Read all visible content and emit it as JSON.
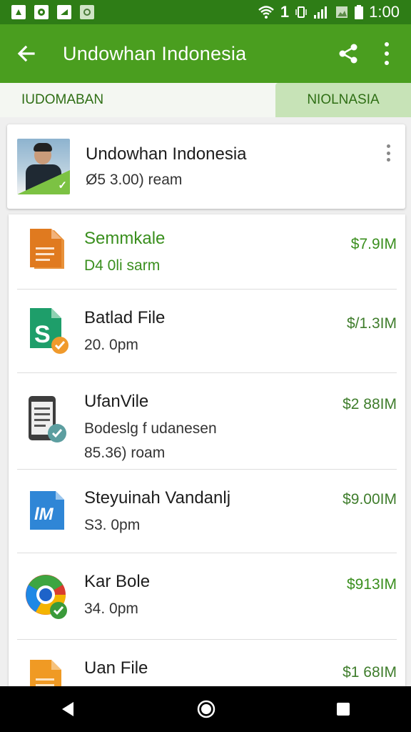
{
  "status_bar": {
    "time": "1:00",
    "notification_count": "1",
    "icons": [
      "app-icon",
      "record-icon",
      "cast-icon",
      "image-icon"
    ]
  },
  "app_bar": {
    "title": "Undowhan Indonesia",
    "icons": [
      "back-arrow-icon",
      "share-icon",
      "more-vert-icon"
    ]
  },
  "tabs": [
    {
      "label": "IUDOMABAN",
      "selected": false
    },
    {
      "label": "NIOLNASIA",
      "selected": true
    }
  ],
  "header_card": {
    "name": "Undowhan Indonesia",
    "subtitle": "Ø5 3.00) ream"
  },
  "files": [
    {
      "name": "Semmkale",
      "line1": "D4 0li sarm",
      "line2": "",
      "amount": "$7.9IM",
      "icon": "document-orange-icon",
      "name_green": true
    },
    {
      "name": "Batlad File",
      "line1": "20. 0pm",
      "line2": "",
      "amount": "$/1.3IM",
      "icon": "sheets-green-icon",
      "name_green": false
    },
    {
      "name": "UfanVile",
      "line1": "Bodeslg f udanesen",
      "line2": "85.36) roam",
      "amount": "$2 88IM",
      "icon": "phone-document-icon",
      "name_green": false
    },
    {
      "name": "Steyuinah Vandanlj",
      "line1": "S3. 0pm",
      "line2": "",
      "amount": "$9.00IM",
      "icon": "blue-image-file-icon",
      "name_green": false
    },
    {
      "name": "Kar Bole",
      "line1": "34. 0pm",
      "line2": "",
      "amount": "$913IM",
      "icon": "chrome-file-icon",
      "name_green": false
    },
    {
      "name": "Uan File",
      "line1": "",
      "line2": "",
      "amount": "$1 68IM",
      "icon": "document-orange-icon",
      "name_green": false
    }
  ],
  "colors": {
    "status_bar": "#2e7d16",
    "app_bar": "#4a9e1f",
    "accent_green": "#3a8f1e",
    "tab_selected_bg": "#c7e3b7"
  },
  "nav_bar_icons": [
    "back-triangle-icon",
    "home-circle-icon",
    "recents-square-icon"
  ]
}
